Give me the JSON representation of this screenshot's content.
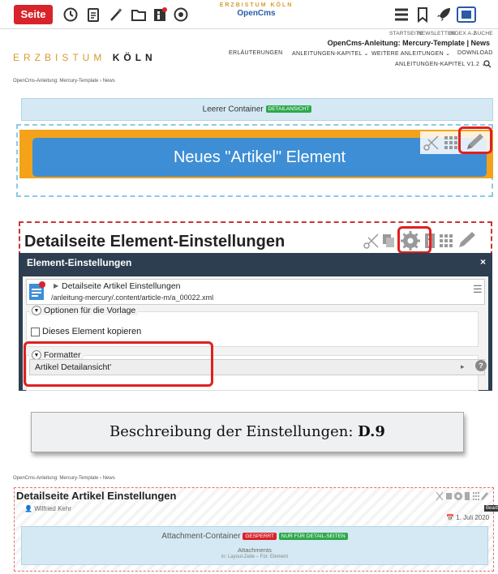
{
  "toolbar": {
    "seite_label": "Seite",
    "icons": [
      "history-icon",
      "clipboard-icon",
      "magic-wand-icon",
      "folder-icon",
      "info-icon",
      "target-icon",
      "menu-icon",
      "bookmark-icon",
      "rocket-icon",
      "selection-icon"
    ],
    "logo_line1": "ERZBISTUM KÖLN",
    "logo_line2": "OpenCms"
  },
  "header": {
    "topnav": [
      "STARTSEITE",
      "NEWSLETTER",
      "INDEX A-Z",
      "SUCHE"
    ],
    "site_title": "OpenCms-Anleitung: Mercury-Template | News",
    "mainnav": [
      "ERLÄUTERUNGEN",
      "ANLEITUNGEN-KAPITEL ⌄",
      "WEITERE ANLEITUNGEN ⌄",
      "DOWNLOAD"
    ],
    "mainnav2": "ANLEITUNGEN-KAPITEL V1.2 ⌄",
    "logo_part1": "ERZBISTUM",
    "logo_part2": "KÖLN",
    "breadcrumb": "OpenCms-Anleitung: Mercury-Template  ›  News"
  },
  "container": {
    "leerer_label": "Leerer Container",
    "leerer_badge": "DETAILANSICHT",
    "neues_label": "Neues \"Artikel\" Element"
  },
  "detail": {
    "title": "Detailseite Element-Einstellungen"
  },
  "dialog": {
    "title": "Element-Einstellungen",
    "close": "×",
    "resource_title": "Detailseite Artikel Einstellungen",
    "resource_path": "/anleitung-mercury/.content/article-m/a_00022.xml",
    "section1": "Optionen für die Vorlage",
    "checkbox_label": "Dieses Element kopieren",
    "section2": "Formatter",
    "formatter_value": "Artikel Detailansicht'"
  },
  "description": {
    "prefix": "Beschreibung der Einstellungen: ",
    "code": "D.9"
  },
  "preview": {
    "breadcrumb": "OpenCms-Anleitung: Mercury-Template  ›  News",
    "title": "Detailseite Artikel Einstellungen",
    "author": "Wilfried Kehr",
    "date": "1. Juli 2020",
    "bearbeiten": "Bearbeite",
    "attach_title": "Attachment-Container",
    "badge_gesperrt": "GESPERRT",
    "badge_detail": "NUR FÜR DETAIL-SEITEN",
    "attach_sub1": "Attachments",
    "attach_sub2": "in: Layout-Zeile – Für: Element"
  },
  "colors": {
    "accent_red": "#d8232a",
    "highlight_red": "#e02020",
    "dialog_header": "#2c3e50",
    "container_blue": "#d4e9f3",
    "element_orange": "#f4a21a",
    "element_blue": "#3e8ed5",
    "badge_green": "#2ea84b"
  }
}
